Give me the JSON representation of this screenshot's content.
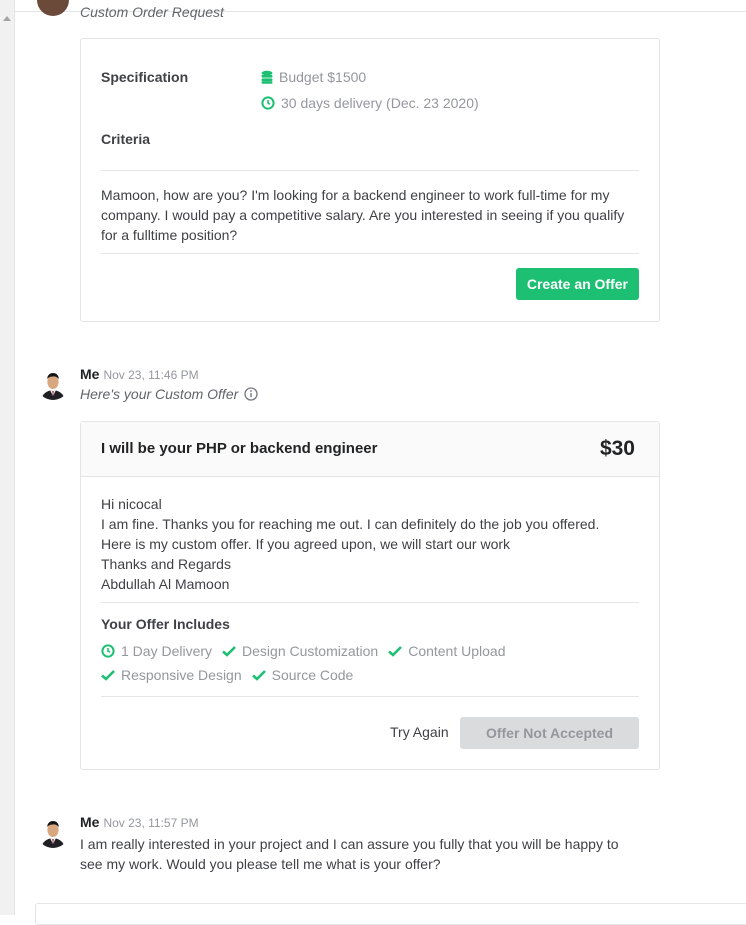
{
  "top_message": {
    "subtitle": "Custom Order Request"
  },
  "request_card": {
    "spec_label": "Specification",
    "budget": "Budget $1500",
    "delivery": "30 days delivery (Dec. 23 2020)",
    "criteria_label": "Criteria",
    "message": "Mamoon, how are you? I'm looking for a backend engineer to work full-time for my company. I would pay a competitive salary. Are you interested in seeing if you qualify for a fulltime position?",
    "create_offer_label": "Create an Offer"
  },
  "offer_message": {
    "sender": "Me",
    "time": "Nov 23, 11:46 PM",
    "subtitle": "Here's your Custom Offer"
  },
  "offer_card": {
    "title": "I will be your PHP or backend engineer",
    "price": "$30",
    "body_lines": [
      "Hi nicocal",
      "I am fine. Thanks you for reaching me out. I can definitely do the job you offered.",
      "Here is my custom offer. If you agreed upon, we will start our work",
      "Thanks and Regards",
      "Abdullah Al Mamoon"
    ],
    "includes_title": "Your Offer Includes",
    "includes": [
      "1 Day Delivery",
      "Design Customization",
      "Content Upload",
      "Responsive Design",
      "Source Code"
    ],
    "try_again_label": "Try Again",
    "status_label": "Offer Not Accepted"
  },
  "last_message": {
    "sender": "Me",
    "time": "Nov 23, 11:57 PM",
    "text": "I am really interested in your project and I can assure you fully that you will be happy to see my work. Would you please tell me what is your offer?"
  },
  "colors": {
    "accent": "#1dbf73",
    "muted": "#95979d",
    "text": "#404145"
  }
}
